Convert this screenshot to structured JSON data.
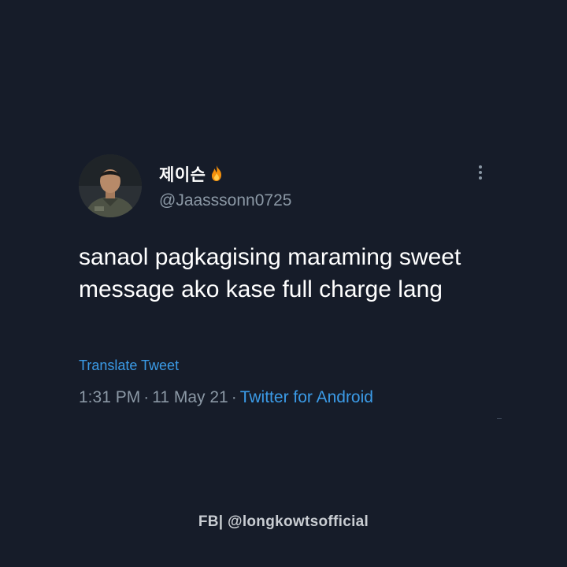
{
  "tweet": {
    "display_name": "제이슨",
    "handle": "@Jaasssonn0725",
    "text": "sanaol pagkagising maraming sweet message ako kase full charge lang",
    "translate_label": "Translate Tweet",
    "time": "1:31 PM",
    "date": "11 May 21",
    "separator": "·",
    "source": "Twitter for Android",
    "name_emoji_icon": "flame-icon",
    "menu_icon": "more-vertical-icon"
  },
  "footer": {
    "credit": "FB| @longkowtsofficial"
  },
  "colors": {
    "background": "#161c29",
    "primary_text": "#ffffff",
    "secondary_text": "#8b98a5",
    "link": "#3b9be7"
  }
}
